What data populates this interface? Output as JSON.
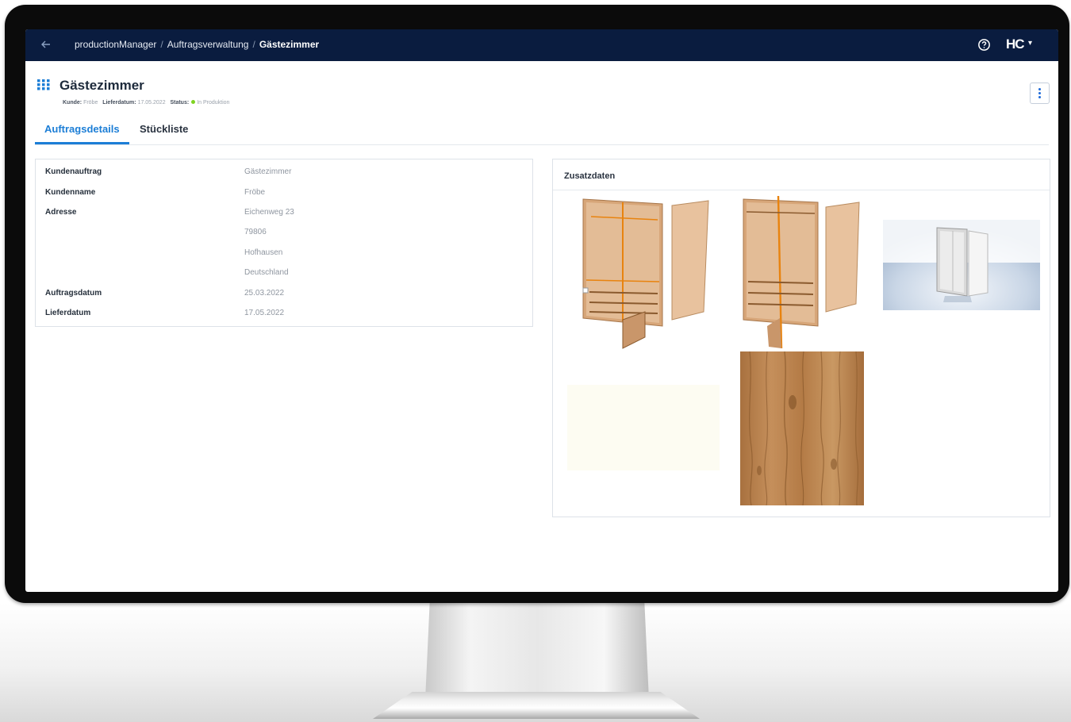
{
  "header": {
    "breadcrumb": [
      "productionManager",
      "Auftragsverwaltung",
      "Gästezimmer"
    ],
    "separator": "/",
    "logo_text": "HC",
    "icons": {
      "back": "arrow-left-icon",
      "help": "help-circle-icon",
      "user_menu": "chevron-down-icon"
    }
  },
  "page": {
    "title": "Gästezimmer",
    "meta": {
      "kunde_label": "Kunde:",
      "kunde_value": "Fröbe",
      "liefer_label": "Lieferdatum:",
      "liefer_value": "17.05.2022",
      "status_label": "Status:",
      "status_value": "In Produktion",
      "status_color": "#7ed321"
    }
  },
  "tabs": [
    {
      "label": "Auftragsdetails",
      "active": true
    },
    {
      "label": "Stückliste",
      "active": false
    }
  ],
  "details": [
    {
      "label": "Kundenauftrag",
      "value": "Gästezimmer"
    },
    {
      "label": "Kundenname",
      "value": "Fröbe"
    },
    {
      "label": "Adresse",
      "value": "Eichenweg 23"
    },
    {
      "label": "",
      "value": "79806"
    },
    {
      "label": "",
      "value": "Hofhausen"
    },
    {
      "label": "",
      "value": "Deutschland"
    },
    {
      "label": "Auftragsdatum",
      "value": "25.03.2022"
    },
    {
      "label": "Lieferdatum",
      "value": "17.05.2022"
    }
  ],
  "extra": {
    "title": "Zusatzdaten",
    "thumbnails": [
      "wardrobe-exploded-view",
      "wardrobe-frame-view",
      "wardrobe-3d-render",
      "color-swatch-cream",
      "oak-wood-texture"
    ]
  },
  "colors": {
    "header_bg": "#0a1c3f",
    "accent": "#1c7ed6",
    "wood": "#d6a77a",
    "frame": "#e8830f"
  }
}
